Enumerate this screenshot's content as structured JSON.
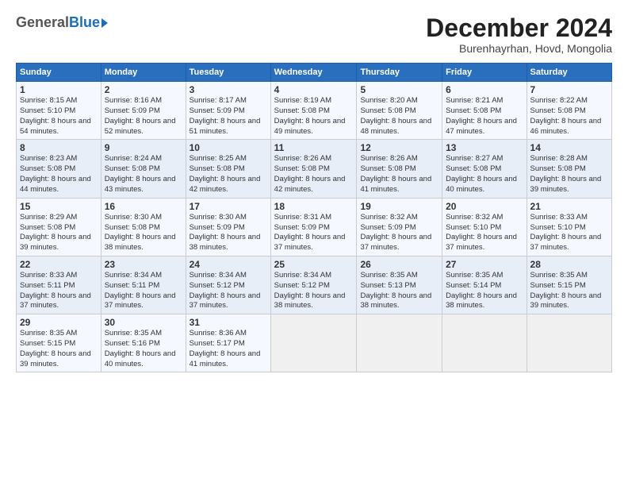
{
  "logo": {
    "general": "General",
    "blue": "Blue"
  },
  "header": {
    "month_title": "December 2024",
    "location": "Burenhayrhan, Hovd, Mongolia"
  },
  "weekdays": [
    "Sunday",
    "Monday",
    "Tuesday",
    "Wednesday",
    "Thursday",
    "Friday",
    "Saturday"
  ],
  "weeks": [
    [
      {
        "day": "1",
        "sunrise": "8:15 AM",
        "sunset": "5:10 PM",
        "daylight": "8 hours and 54 minutes."
      },
      {
        "day": "2",
        "sunrise": "8:16 AM",
        "sunset": "5:09 PM",
        "daylight": "8 hours and 52 minutes."
      },
      {
        "day": "3",
        "sunrise": "8:17 AM",
        "sunset": "5:09 PM",
        "daylight": "8 hours and 51 minutes."
      },
      {
        "day": "4",
        "sunrise": "8:19 AM",
        "sunset": "5:08 PM",
        "daylight": "8 hours and 49 minutes."
      },
      {
        "day": "5",
        "sunrise": "8:20 AM",
        "sunset": "5:08 PM",
        "daylight": "8 hours and 48 minutes."
      },
      {
        "day": "6",
        "sunrise": "8:21 AM",
        "sunset": "5:08 PM",
        "daylight": "8 hours and 47 minutes."
      },
      {
        "day": "7",
        "sunrise": "8:22 AM",
        "sunset": "5:08 PM",
        "daylight": "8 hours and 46 minutes."
      }
    ],
    [
      {
        "day": "8",
        "sunrise": "8:23 AM",
        "sunset": "5:08 PM",
        "daylight": "8 hours and 44 minutes."
      },
      {
        "day": "9",
        "sunrise": "8:24 AM",
        "sunset": "5:08 PM",
        "daylight": "8 hours and 43 minutes."
      },
      {
        "day": "10",
        "sunrise": "8:25 AM",
        "sunset": "5:08 PM",
        "daylight": "8 hours and 42 minutes."
      },
      {
        "day": "11",
        "sunrise": "8:26 AM",
        "sunset": "5:08 PM",
        "daylight": "8 hours and 42 minutes."
      },
      {
        "day": "12",
        "sunrise": "8:26 AM",
        "sunset": "5:08 PM",
        "daylight": "8 hours and 41 minutes."
      },
      {
        "day": "13",
        "sunrise": "8:27 AM",
        "sunset": "5:08 PM",
        "daylight": "8 hours and 40 minutes."
      },
      {
        "day": "14",
        "sunrise": "8:28 AM",
        "sunset": "5:08 PM",
        "daylight": "8 hours and 39 minutes."
      }
    ],
    [
      {
        "day": "15",
        "sunrise": "8:29 AM",
        "sunset": "5:08 PM",
        "daylight": "8 hours and 39 minutes."
      },
      {
        "day": "16",
        "sunrise": "8:30 AM",
        "sunset": "5:08 PM",
        "daylight": "8 hours and 38 minutes."
      },
      {
        "day": "17",
        "sunrise": "8:30 AM",
        "sunset": "5:09 PM",
        "daylight": "8 hours and 38 minutes."
      },
      {
        "day": "18",
        "sunrise": "8:31 AM",
        "sunset": "5:09 PM",
        "daylight": "8 hours and 37 minutes."
      },
      {
        "day": "19",
        "sunrise": "8:32 AM",
        "sunset": "5:09 PM",
        "daylight": "8 hours and 37 minutes."
      },
      {
        "day": "20",
        "sunrise": "8:32 AM",
        "sunset": "5:10 PM",
        "daylight": "8 hours and 37 minutes."
      },
      {
        "day": "21",
        "sunrise": "8:33 AM",
        "sunset": "5:10 PM",
        "daylight": "8 hours and 37 minutes."
      }
    ],
    [
      {
        "day": "22",
        "sunrise": "8:33 AM",
        "sunset": "5:11 PM",
        "daylight": "8 hours and 37 minutes."
      },
      {
        "day": "23",
        "sunrise": "8:34 AM",
        "sunset": "5:11 PM",
        "daylight": "8 hours and 37 minutes."
      },
      {
        "day": "24",
        "sunrise": "8:34 AM",
        "sunset": "5:12 PM",
        "daylight": "8 hours and 37 minutes."
      },
      {
        "day": "25",
        "sunrise": "8:34 AM",
        "sunset": "5:12 PM",
        "daylight": "8 hours and 38 minutes."
      },
      {
        "day": "26",
        "sunrise": "8:35 AM",
        "sunset": "5:13 PM",
        "daylight": "8 hours and 38 minutes."
      },
      {
        "day": "27",
        "sunrise": "8:35 AM",
        "sunset": "5:14 PM",
        "daylight": "8 hours and 38 minutes."
      },
      {
        "day": "28",
        "sunrise": "8:35 AM",
        "sunset": "5:15 PM",
        "daylight": "8 hours and 39 minutes."
      }
    ],
    [
      {
        "day": "29",
        "sunrise": "8:35 AM",
        "sunset": "5:15 PM",
        "daylight": "8 hours and 39 minutes."
      },
      {
        "day": "30",
        "sunrise": "8:35 AM",
        "sunset": "5:16 PM",
        "daylight": "8 hours and 40 minutes."
      },
      {
        "day": "31",
        "sunrise": "8:36 AM",
        "sunset": "5:17 PM",
        "daylight": "8 hours and 41 minutes."
      },
      null,
      null,
      null,
      null
    ]
  ]
}
